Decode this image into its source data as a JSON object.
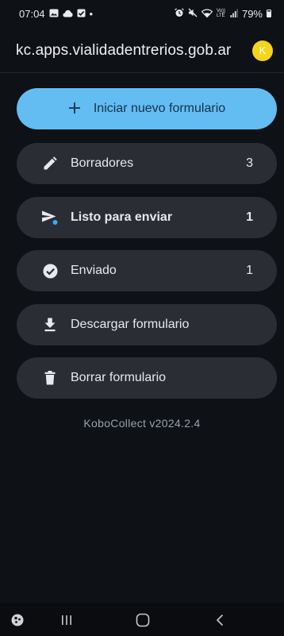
{
  "status_bar": {
    "time": "07:04",
    "dot": "•",
    "battery_pct": "79%",
    "network": "Vo)) LTE",
    "icons_left": [
      "photo-icon",
      "cloud-icon",
      "check-box-icon"
    ],
    "icons_right": [
      "alarm-icon",
      "mute-icon",
      "wifi-icon",
      "signal-icon",
      "battery-icon"
    ]
  },
  "app_bar": {
    "title": "kc.apps.vialidadentrerios.gob.ar",
    "avatar_letter": "K",
    "avatar_color": "#f6d41c"
  },
  "menu": {
    "new_form": {
      "label": "Iniciar nuevo formulario",
      "icon": "plus-icon"
    },
    "items": [
      {
        "label": "Borradores",
        "count": "3",
        "icon": "pencil-icon",
        "bold": false
      },
      {
        "label": "Listo para enviar",
        "count": "1",
        "icon": "send-icon",
        "bold": true
      },
      {
        "label": "Enviado",
        "count": "1",
        "icon": "check-circle-icon",
        "bold": false
      },
      {
        "label": "Descargar formulario",
        "count": "",
        "icon": "download-icon",
        "bold": false
      },
      {
        "label": "Borrar formulario",
        "count": "",
        "icon": "trash-icon",
        "bold": false
      }
    ]
  },
  "version": "KoboCollect v2024.2.4",
  "colors": {
    "accent": "#63bdf2",
    "item_bg": "#2a2e34",
    "background": "#0e1115",
    "notification_dot": "#3fa9f5"
  },
  "nav_bar": {
    "buttons": [
      "accessibility-icon",
      "recents-icon",
      "home-icon",
      "back-icon"
    ]
  }
}
